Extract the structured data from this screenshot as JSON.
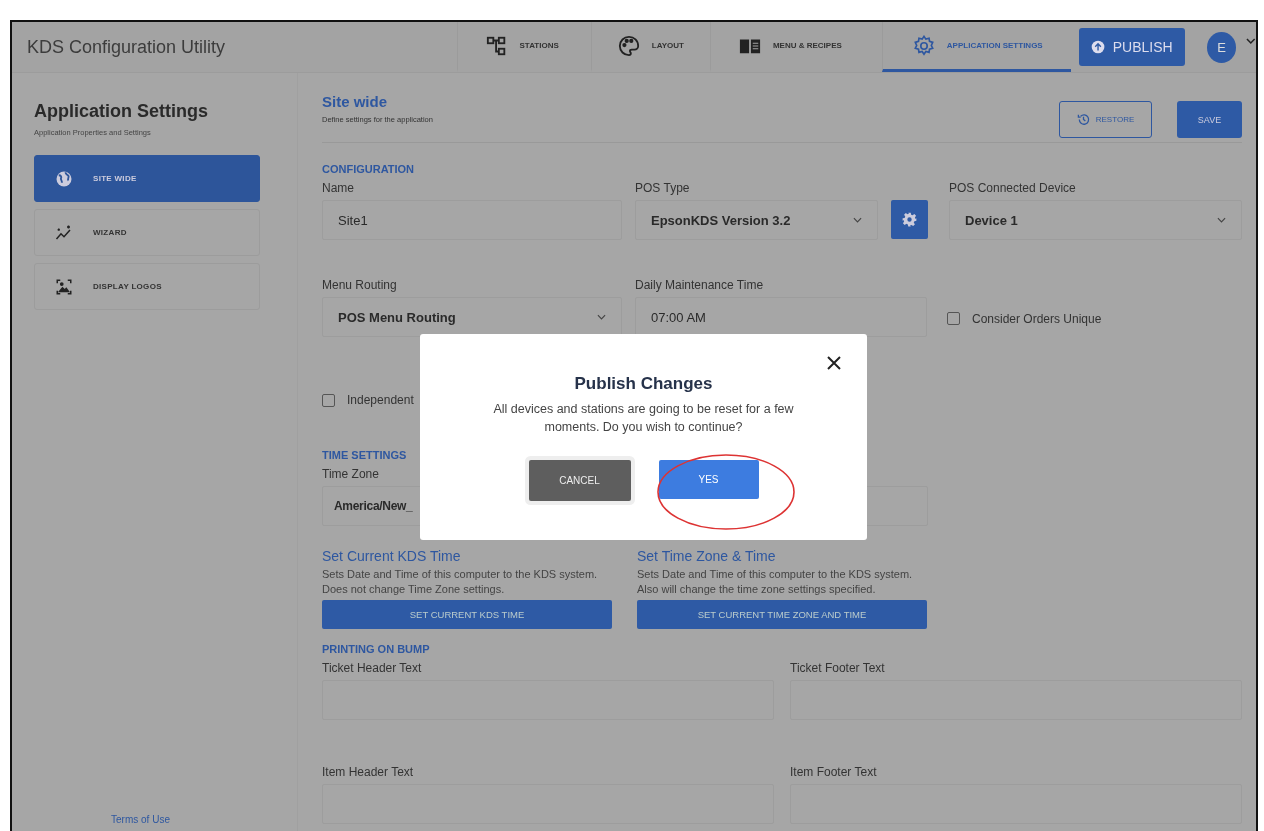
{
  "header": {
    "title": "KDS Configuration Utility",
    "tabs": [
      {
        "label": "STATIONS",
        "selected": false
      },
      {
        "label": "LAYOUT",
        "selected": false
      },
      {
        "label": "MENU & RECIPES",
        "selected": false
      },
      {
        "label": "APPLICATION SETTINGS",
        "selected": true
      }
    ],
    "publish": "PUBLISH",
    "avatar": "E"
  },
  "sidebar": {
    "title": "Application Settings",
    "subtitle": "Application Properties and Settings",
    "items": [
      {
        "label": "SITE WIDE",
        "selected": true
      },
      {
        "label": "WIZARD",
        "selected": false
      },
      {
        "label": "DISPLAY LOGOS",
        "selected": false
      }
    ],
    "footer_link": "Terms of Use"
  },
  "main": {
    "title": "Site wide",
    "subtitle": "Define settings for the application",
    "restore": "RESTORE",
    "save": "SAVE",
    "configuration": {
      "heading": "CONFIGURATION",
      "name": {
        "label": "Name",
        "value": "Site1"
      },
      "pos_type": {
        "label": "POS Type",
        "value": "EpsonKDS Version 3.2"
      },
      "pos_connected_device": {
        "label": "POS Connected Device",
        "value": "Device 1"
      },
      "menu_routing": {
        "label": "Menu Routing",
        "value": "POS Menu Routing"
      },
      "daily_maintenance_time": {
        "label": "Daily Maintenance Time",
        "value": "07:00 AM"
      },
      "consider_orders_unique": {
        "label": "Consider Orders Unique",
        "checked": false
      },
      "independent": {
        "label": "Independent",
        "checked": false
      }
    },
    "time_settings": {
      "heading": "TIME SETTINGS",
      "time_zone": {
        "label": "Time Zone",
        "value": "America/New_"
      },
      "actions": [
        {
          "title": "Set Current KDS Time",
          "description": "Sets Date and Time of this computer to the KDS system. Does not change Time Zone settings.",
          "button": "SET CURRENT KDS TIME"
        },
        {
          "title": "Set Time Zone & Time",
          "description": "Sets Date and Time of this computer to the KDS system. Also will change the time zone settings specified.",
          "button": "SET CURRENT TIME ZONE AND TIME"
        }
      ]
    },
    "printing_on_bump": {
      "heading": "PRINTING ON BUMP",
      "fields": [
        {
          "label": "Ticket Header Text"
        },
        {
          "label": "Ticket Footer Text"
        },
        {
          "label": "Item Header Text"
        },
        {
          "label": "Item Footer Text"
        }
      ]
    }
  },
  "dialog": {
    "title": "Publish Changes",
    "message": "All devices and stations are going to be reset for a few moments. Do you wish to continue?",
    "cancel": "CANCEL",
    "yes": "YES"
  }
}
